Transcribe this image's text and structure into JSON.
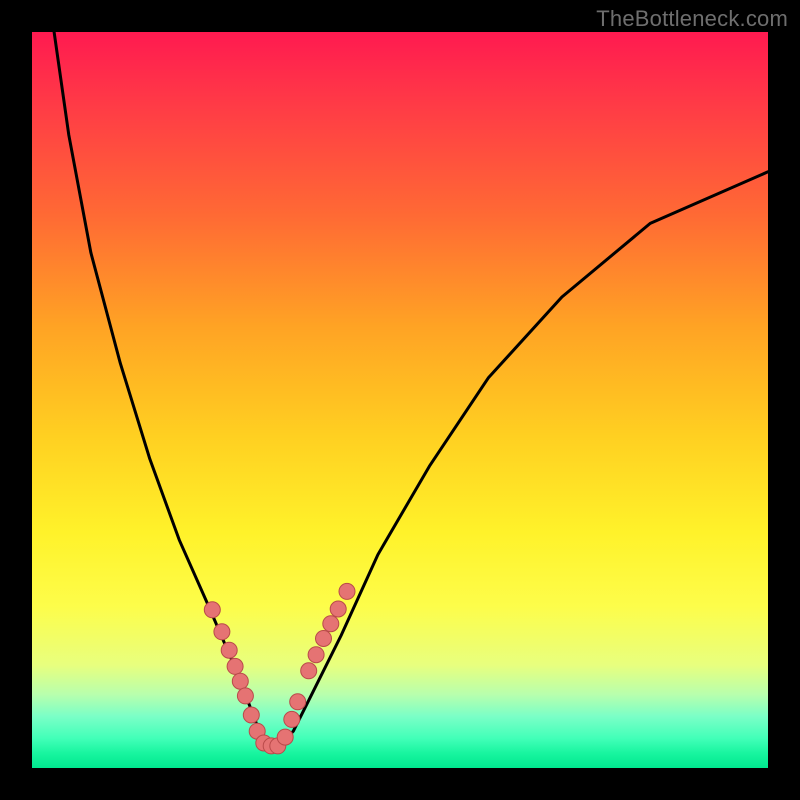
{
  "watermark": "TheBottleneck.com",
  "chart_data": {
    "type": "line",
    "title": "",
    "xlabel": "",
    "ylabel": "",
    "xlim": [
      0,
      100
    ],
    "ylim": [
      0,
      100
    ],
    "grid": false,
    "series": [
      {
        "name": "curve",
        "x": [
          3,
          5,
          8,
          12,
          16,
          20,
          24,
          27,
          29,
          30.5,
          32,
          33.5,
          35.5,
          38,
          42,
          47,
          54,
          62,
          72,
          84,
          100
        ],
        "y": [
          100,
          86,
          70,
          55,
          42,
          31,
          22,
          15,
          10,
          6,
          3,
          3,
          5,
          10,
          18,
          29,
          41,
          53,
          64,
          74,
          81
        ]
      }
    ],
    "markers": {
      "name": "highlighted-points",
      "x": [
        24.5,
        25.8,
        26.8,
        27.6,
        28.3,
        29.0,
        29.8,
        30.6,
        31.5,
        32.5,
        33.4,
        34.4,
        35.3,
        36.1,
        37.6,
        38.6,
        39.6,
        40.6,
        41.6,
        42.8
      ],
      "y": [
        21.5,
        18.5,
        16.0,
        13.8,
        11.8,
        9.8,
        7.2,
        5.0,
        3.4,
        3.0,
        3.0,
        4.2,
        6.6,
        9.0,
        13.2,
        15.4,
        17.6,
        19.6,
        21.6,
        24.0
      ]
    }
  }
}
